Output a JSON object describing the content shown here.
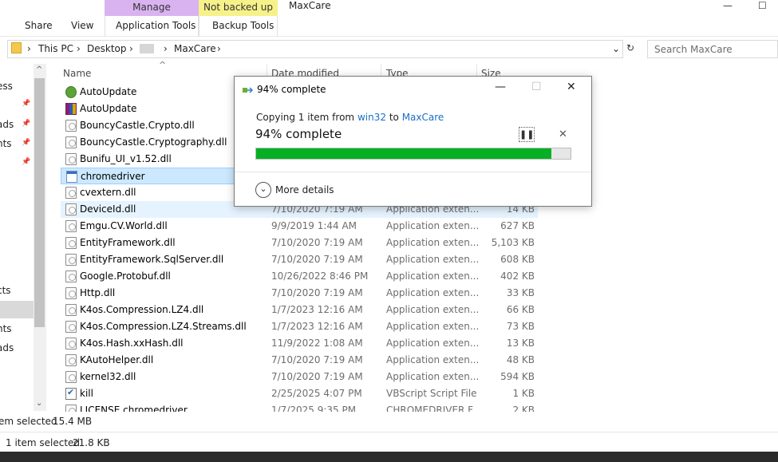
{
  "window": {
    "title": "MaxCare",
    "controls": {
      "minimize": "—",
      "maximize": "☐"
    }
  },
  "ribbon": {
    "context_tabs": [
      {
        "label": "Manage"
      },
      {
        "label": "Not backed up"
      }
    ],
    "tabs": [
      {
        "label": "Share"
      },
      {
        "label": "View"
      },
      {
        "label": "Application Tools"
      },
      {
        "label": "Backup Tools"
      }
    ]
  },
  "address": {
    "crumbs": [
      "This PC",
      "Desktop",
      "MaxCare"
    ],
    "separator": "›",
    "dropdown": "⌄",
    "refresh": "↻"
  },
  "search": {
    "placeholder": "Search MaxCare"
  },
  "nav": {
    "items": [
      {
        "label": "ess"
      },
      {
        "label": "ads"
      },
      {
        "label": "nts"
      },
      {
        "label": "cts"
      },
      {
        "label": "nts"
      },
      {
        "label": "ads"
      }
    ],
    "pin": "📌"
  },
  "columns": {
    "name": "Name",
    "date": "Date modified",
    "type": "Type",
    "size": "Size",
    "sort_indicator": "^"
  },
  "files": [
    {
      "name": "AutoUpdate",
      "date": "",
      "type": "",
      "size": "",
      "icon": "globe-icon"
    },
    {
      "name": "AutoUpdate",
      "date": "",
      "type": "",
      "size": "",
      "icon": "archive-icon"
    },
    {
      "name": "BouncyCastle.Crypto.dll",
      "date": "",
      "type": "",
      "size": "",
      "icon": "dll-icon"
    },
    {
      "name": "BouncyCastle.Cryptography.dll",
      "date": "",
      "type": "",
      "size": "",
      "icon": "dll-icon"
    },
    {
      "name": "Bunifu_UI_v1.52.dll",
      "date": "",
      "type": "",
      "size": "",
      "icon": "dll-icon"
    },
    {
      "name": "chromedriver",
      "date": "",
      "type": "",
      "size": "",
      "icon": "exe-icon"
    },
    {
      "name": "cvextern.dll",
      "date": "",
      "type": "",
      "size": "",
      "icon": "dll-icon"
    },
    {
      "name": "DeviceId.dll",
      "date": "7/10/2020 7:19 AM",
      "type": "Application exten...",
      "size": "14 KB",
      "icon": "dll-icon"
    },
    {
      "name": "Emgu.CV.World.dll",
      "date": "9/9/2019 1:44 AM",
      "type": "Application exten...",
      "size": "627 KB",
      "icon": "dll-icon"
    },
    {
      "name": "EntityFramework.dll",
      "date": "7/10/2020 7:19 AM",
      "type": "Application exten...",
      "size": "5,103 KB",
      "icon": "dll-icon"
    },
    {
      "name": "EntityFramework.SqlServer.dll",
      "date": "7/10/2020 7:19 AM",
      "type": "Application exten...",
      "size": "608 KB",
      "icon": "dll-icon"
    },
    {
      "name": "Google.Protobuf.dll",
      "date": "10/26/2022 8:46 PM",
      "type": "Application exten...",
      "size": "402 KB",
      "icon": "dll-icon"
    },
    {
      "name": "Http.dll",
      "date": "7/10/2020 7:19 AM",
      "type": "Application exten...",
      "size": "33 KB",
      "icon": "dll-icon"
    },
    {
      "name": "K4os.Compression.LZ4.dll",
      "date": "1/7/2023 12:16 AM",
      "type": "Application exten...",
      "size": "66 KB",
      "icon": "dll-icon"
    },
    {
      "name": "K4os.Compression.LZ4.Streams.dll",
      "date": "1/7/2023 12:16 AM",
      "type": "Application exten...",
      "size": "73 KB",
      "icon": "dll-icon"
    },
    {
      "name": "K4os.Hash.xxHash.dll",
      "date": "11/9/2022 1:08 AM",
      "type": "Application exten...",
      "size": "13 KB",
      "icon": "dll-icon"
    },
    {
      "name": "KAutoHelper.dll",
      "date": "7/10/2020 7:19 AM",
      "type": "Application exten...",
      "size": "48 KB",
      "icon": "dll-icon"
    },
    {
      "name": "kernel32.dll",
      "date": "7/10/2020 7:19 AM",
      "type": "Application exten...",
      "size": "594 KB",
      "icon": "dll-icon"
    },
    {
      "name": "kill",
      "date": "2/25/2025 4:07 PM",
      "type": "VBScript Script File",
      "size": "1 KB",
      "icon": "script-icon"
    },
    {
      "name": "LICENSE.chromedriver",
      "date": "1/7/2025 9:35 PM",
      "type": "CHROMEDRIVER F...",
      "size": "2 KB",
      "icon": "dll-icon"
    }
  ],
  "status_inner": {
    "selected": "em selected",
    "size": "15.4 MB"
  },
  "status_outer": {
    "selected": "1 item selected",
    "size": "21.8 KB"
  },
  "dialog": {
    "title": "94% complete",
    "controls": {
      "minimize": "—",
      "maximize": "☐",
      "close": "✕"
    },
    "copy_prefix": "Copying 1 item from",
    "source": "win32",
    "to_word": "to",
    "destination": "MaxCare",
    "percent_label": "94% complete",
    "pause_glyph": "❚❚",
    "stop_glyph": "✕",
    "progress": 0.94,
    "progress_color": "#06b025",
    "more_glyph": "⌄",
    "more_details": "More details"
  }
}
